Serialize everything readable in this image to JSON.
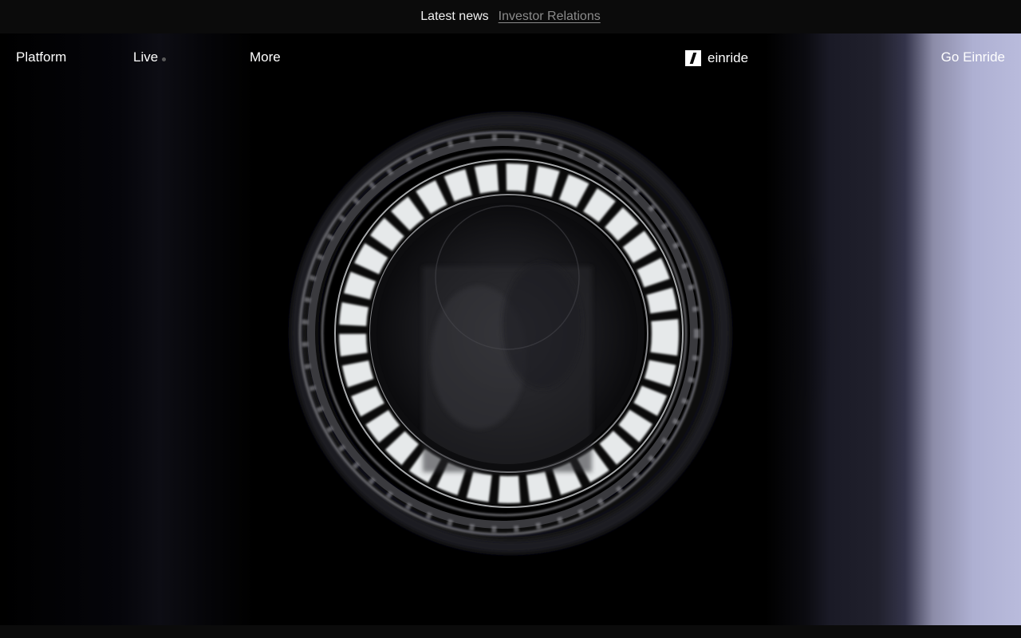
{
  "announcement": {
    "text": "Latest news",
    "link_label": "Investor Relations"
  },
  "nav": {
    "platform": "Platform",
    "live": "Live",
    "more": "More",
    "cta": "Go Einride"
  },
  "logo": {
    "text": "einride",
    "icon": "einride-mark-icon"
  },
  "hero": {
    "subject": "light-ring-icon"
  },
  "colors": {
    "background": "#000000",
    "bar": "#0b0b0b",
    "text": "#ffffff",
    "link_muted": "#8b8b8b",
    "led": "#e6e9ea",
    "truck_side": "#b9bbdc"
  }
}
